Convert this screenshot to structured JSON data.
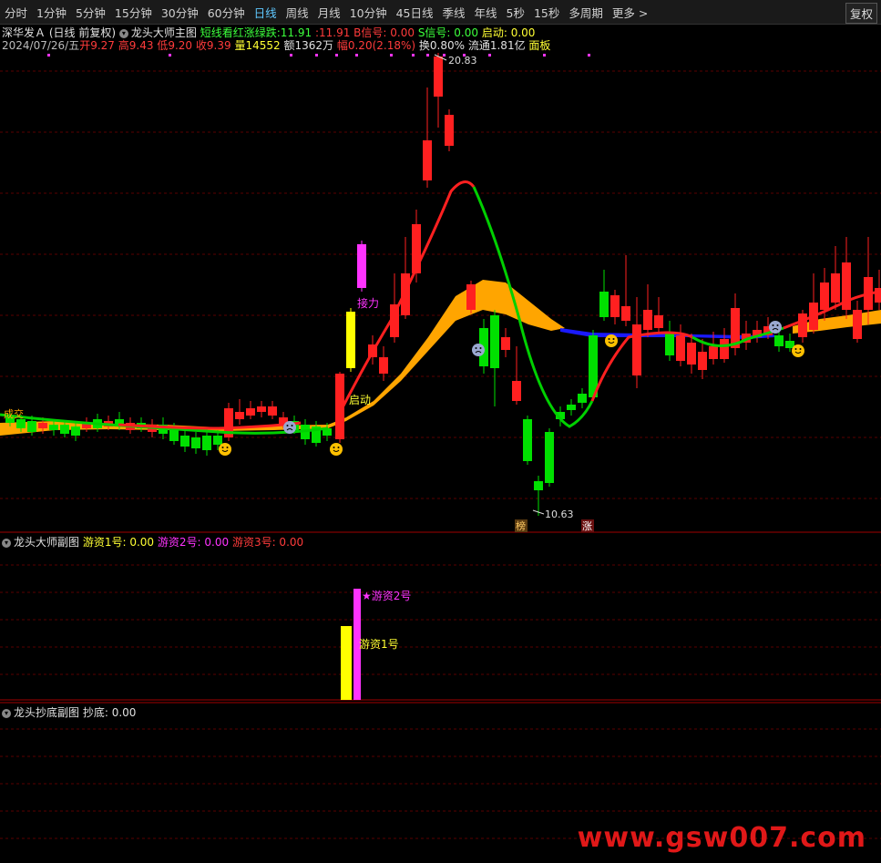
{
  "toolbar": {
    "items": [
      "分时",
      "1分钟",
      "5分钟",
      "15分钟",
      "30分钟",
      "60分钟",
      "日线",
      "周线",
      "月线",
      "10分钟",
      "45日线",
      "季线",
      "年线",
      "5秒",
      "15秒",
      "多周期",
      "更多 >"
    ],
    "active": "日线",
    "right_button": "复权"
  },
  "stock": {
    "name": "深华发Ａ",
    "mode": "(日线 前复权)",
    "indicator_name": "龙头大师主图",
    "short_line_label": "短线看红涨绿跌:",
    "short_line_value_1": "11.91",
    "short_line_value_2": ":11.91",
    "b_signal": "B信号: 0.00",
    "s_signal": "S信号: 0.00",
    "start_signal": "启动: 0.00"
  },
  "quote": {
    "date": "2024/07/26/五",
    "open": "开9.27",
    "high": "高9.43",
    "low": "低9.20",
    "close": "收9.39",
    "volume": "量14552",
    "amount": "额1362万",
    "change": "幅0.20(2.18%)",
    "turnover": "换0.80%",
    "float": "流通1.81亿",
    "board": "面板"
  },
  "main_chart": {
    "high_label": "20.83",
    "low_label": "10.63",
    "label_jieli": "接力",
    "label_qidong": "启动",
    "label_bang": "榜",
    "label_zhang": "涨",
    "label_left": "成交"
  },
  "sub1": {
    "title": "龙头大师副图",
    "item1": "游资1号: 0.00",
    "item2": "游资2号: 0.00",
    "item3": "游资3号: 0.00",
    "bar_label_1": "游资1号",
    "bar_label_2": "★游资2号"
  },
  "sub2": {
    "title": "龙头抄底副图",
    "item1": "抄底: 0.00"
  },
  "colors": {
    "up": "#ff2020",
    "down": "#00e000",
    "ma_orange": "#ffa500",
    "ma_blue": "#1a1aff",
    "magenta": "#ff33ff",
    "yellow": "#ffff00"
  },
  "watermark": "www.gsw007.com"
}
